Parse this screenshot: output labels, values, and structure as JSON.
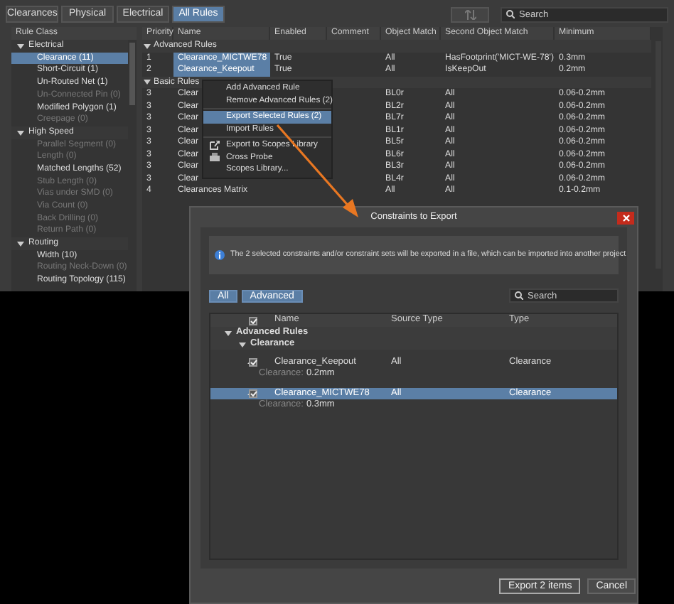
{
  "tabs": [
    {
      "label": "Clearances",
      "selected": false
    },
    {
      "label": "Physical",
      "selected": false
    },
    {
      "label": "Electrical",
      "selected": false
    },
    {
      "label": "All Rules",
      "selected": true
    }
  ],
  "search": {
    "placeholder": "Search"
  },
  "rule_class": {
    "header": "Rule Class",
    "groups": [
      {
        "label": "Electrical",
        "expanded": true,
        "children": [
          {
            "label": "Clearance (11)",
            "selected": true,
            "disabled": false
          },
          {
            "label": "Short-Circuit (1)",
            "selected": false,
            "disabled": false
          },
          {
            "label": "Un-Routed Net (1)",
            "selected": false,
            "disabled": false
          },
          {
            "label": "Un-Connected Pin (0)",
            "selected": false,
            "disabled": true
          },
          {
            "label": "Modified Polygon (1)",
            "selected": false,
            "disabled": false
          },
          {
            "label": "Creepage (0)",
            "selected": false,
            "disabled": true
          }
        ]
      },
      {
        "label": "High Speed",
        "expanded": true,
        "children": [
          {
            "label": "Parallel Segment (0)",
            "selected": false,
            "disabled": true
          },
          {
            "label": "Length (0)",
            "selected": false,
            "disabled": true
          },
          {
            "label": "Matched Lengths (52)",
            "selected": false,
            "disabled": false
          },
          {
            "label": "Stub Length (0)",
            "selected": false,
            "disabled": true
          },
          {
            "label": "Vias under SMD (0)",
            "selected": false,
            "disabled": true
          },
          {
            "label": "Via Count (0)",
            "selected": false,
            "disabled": true
          },
          {
            "label": "Back Drilling (0)",
            "selected": false,
            "disabled": true
          },
          {
            "label": "Return Path (0)",
            "selected": false,
            "disabled": true
          }
        ]
      },
      {
        "label": "Routing",
        "expanded": true,
        "children": [
          {
            "label": "Width (10)",
            "selected": false,
            "disabled": false
          },
          {
            "label": "Routing Neck-Down (0)",
            "selected": false,
            "disabled": true
          },
          {
            "label": "Routing Topology (115)",
            "selected": false,
            "disabled": false
          }
        ]
      }
    ]
  },
  "rules_table": {
    "columns": [
      "Priority",
      "Name",
      "Enabled",
      "Comment",
      "Object Match",
      "Second Object Match",
      "Minimum"
    ],
    "groups": [
      {
        "label": "Advanced Rules",
        "expanded": true,
        "rows": [
          {
            "priority": "1",
            "name": "Clearance_MICTWE78",
            "enabled": "True",
            "object_match": "All",
            "second_object_match": "HasFootprint('MICT-WE-78')",
            "minimum": "0.3mm",
            "selected": true
          },
          {
            "priority": "2",
            "name": "Clearance_Keepout",
            "enabled": "True",
            "object_match": "All",
            "second_object_match": "IsKeepOut",
            "minimum": "0.2mm",
            "selected": true
          }
        ]
      },
      {
        "label": "Basic Rules",
        "expanded": true,
        "rows": [
          {
            "priority": "3",
            "name": "Clear",
            "object_match": "BL0r",
            "second_object_match": "All",
            "minimum": "0.06-0.2mm",
            "selected": false
          },
          {
            "priority": "3",
            "name": "Clear",
            "object_match": "BL2r",
            "second_object_match": "All",
            "minimum": "0.06-0.2mm",
            "selected": false
          },
          {
            "priority": "3",
            "name": "Clear",
            "object_match": "BL7r",
            "second_object_match": "All",
            "minimum": "0.06-0.2mm",
            "selected": false
          },
          {
            "priority": "3",
            "name": "Clear",
            "object_match": "BL1r",
            "second_object_match": "All",
            "minimum": "0.06-0.2mm",
            "selected": false
          },
          {
            "priority": "3",
            "name": "Clear",
            "object_match": "BL5r",
            "second_object_match": "All",
            "minimum": "0.06-0.2mm",
            "selected": false
          },
          {
            "priority": "3",
            "name": "Clear",
            "object_match": "BL6r",
            "second_object_match": "All",
            "minimum": "0.06-0.2mm",
            "selected": false
          },
          {
            "priority": "3",
            "name": "Clear",
            "object_match": "BL3r",
            "second_object_match": "All",
            "minimum": "0.06-0.2mm",
            "selected": false
          },
          {
            "priority": "3",
            "name": "Clear",
            "object_match": "BL4r",
            "second_object_match": "All",
            "minimum": "0.06-0.2mm",
            "selected": false
          },
          {
            "priority": "4",
            "name": "Clearances Matrix",
            "object_match": "All",
            "second_object_match": "All",
            "minimum": "0.1-0.2mm",
            "selected": false
          }
        ]
      }
    ]
  },
  "context_menu": {
    "items": [
      {
        "label": "Add Advanced Rule",
        "kind": "text",
        "selected": false,
        "separator_before": false
      },
      {
        "label": "Remove Advanced Rules (2)",
        "kind": "text",
        "selected": false,
        "separator_before": false
      },
      {
        "label": "Export Selected Rules (2)",
        "kind": "text",
        "selected": true,
        "separator_before": true
      },
      {
        "label": "Import Rules",
        "kind": "text",
        "selected": false,
        "separator_before": false
      },
      {
        "label": "Export to Scopes Library",
        "kind": "export",
        "selected": false,
        "separator_before": true
      },
      {
        "label": "Cross Probe",
        "kind": "probe",
        "selected": false,
        "separator_before": false
      },
      {
        "label": "Scopes Library...",
        "kind": "text",
        "selected": false,
        "separator_before": false
      }
    ]
  },
  "dialog": {
    "title": "Constraints to Export",
    "info": "The 2 selected constraints and/or constraint sets will be exported in a file, which can be imported into another project",
    "filters": [
      {
        "label": "All",
        "selected": true
      },
      {
        "label": "Advanced",
        "selected": true
      }
    ],
    "search": {
      "placeholder": "Search"
    },
    "columns": [
      "Name",
      "Source Type",
      "Type"
    ],
    "header_checked": true,
    "tree": [
      {
        "label": "Advanced Rules",
        "expanded": true,
        "children": [
          {
            "label": "Clearance",
            "expanded": true,
            "items": [
              {
                "name": "Clearance_Keepout",
                "source_type": "All",
                "type": "Clearance",
                "checked": true,
                "selected": false,
                "detail_label": "Clearance:",
                "detail_value": "0.2mm"
              },
              {
                "name": "Clearance_MICTWE78",
                "source_type": "All",
                "type": "Clearance",
                "checked": true,
                "selected": true,
                "detail_label": "Clearance:",
                "detail_value": "0.3mm"
              }
            ]
          }
        ]
      }
    ],
    "buttons": [
      {
        "label": "Export 2 items",
        "default": true
      },
      {
        "label": "Cancel",
        "default": false
      }
    ]
  }
}
